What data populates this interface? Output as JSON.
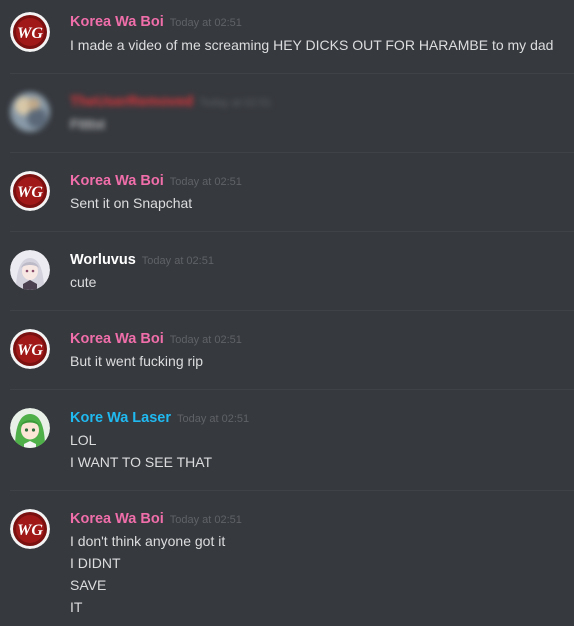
{
  "colors": {
    "background": "#36393e",
    "divider": "#3f4247",
    "timestamp": "#5f6267",
    "message_text": "#dcddde",
    "user_pink": "#f06eaa",
    "user_white": "#ffffff",
    "user_cyan": "#20b9f0",
    "user_red_blurred": "#e0353a"
  },
  "messages": [
    {
      "username": "Korea Wa Boi",
      "timestamp": "Today at 02:51",
      "avatar": "wg-logo-avatar",
      "lines": [
        "I made a video of me screaming HEY DICKS OUT FOR HARAMBE to my dad"
      ]
    },
    {
      "username": "TheUserRemoved",
      "timestamp": "Today at 02:51",
      "avatar": "blurred-avatar",
      "blurred": true,
      "lines": [
        "Fttttst"
      ]
    },
    {
      "username": "Korea Wa Boi",
      "timestamp": "Today at 02:51",
      "avatar": "wg-logo-avatar",
      "lines": [
        "Sent it on Snapchat"
      ]
    },
    {
      "username": "Worluvus",
      "timestamp": "Today at 02:51",
      "avatar": "anime-girl-white-hair-avatar",
      "lines": [
        "cute"
      ]
    },
    {
      "username": "Korea Wa Boi",
      "timestamp": "Today at 02:51",
      "avatar": "wg-logo-avatar",
      "lines": [
        "But it went fucking rip"
      ]
    },
    {
      "username": "Kore Wa Laser",
      "timestamp": "Today at 02:51",
      "avatar": "anime-girl-green-hair-avatar",
      "lines": [
        "LOL",
        "I WANT TO SEE THAT"
      ]
    },
    {
      "username": "Korea Wa Boi",
      "timestamp": "Today at 02:51",
      "avatar": "wg-logo-avatar",
      "lines": [
        "I don't think anyone got it",
        "I DIDNT",
        "SAVE",
        "IT"
      ]
    }
  ]
}
